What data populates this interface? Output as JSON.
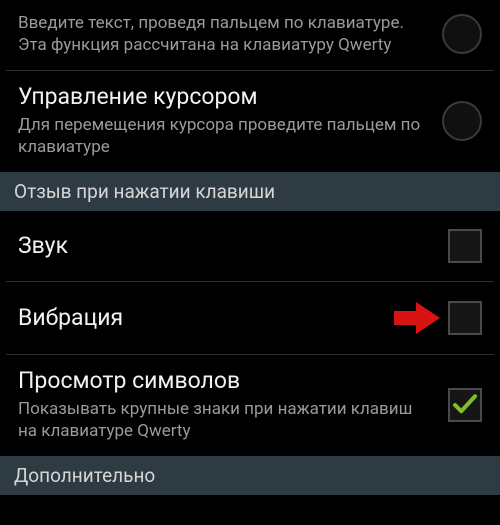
{
  "items": {
    "swipe_input": {
      "subtitle": "Введите текст, проведя пальцем по клавиатуре. Эта функция рассчитана на клавиатуру Qwerty"
    },
    "cursor_control": {
      "title": "Управление курсором",
      "subtitle": "Для перемещения курсора проведите пальцем по клавиатуре"
    },
    "sound": {
      "title": "Звук"
    },
    "vibration": {
      "title": "Вибрация"
    },
    "char_preview": {
      "title": "Просмотр символов",
      "subtitle": "Показывать крупные знаки при нажатии клавиш на клавиатуре Qwerty"
    }
  },
  "sections": {
    "key_feedback": "Отзыв при нажатии клавиши",
    "advanced": "Дополнительно"
  },
  "colors": {
    "arrow": "#d81313",
    "check": "#7fbf2a"
  }
}
